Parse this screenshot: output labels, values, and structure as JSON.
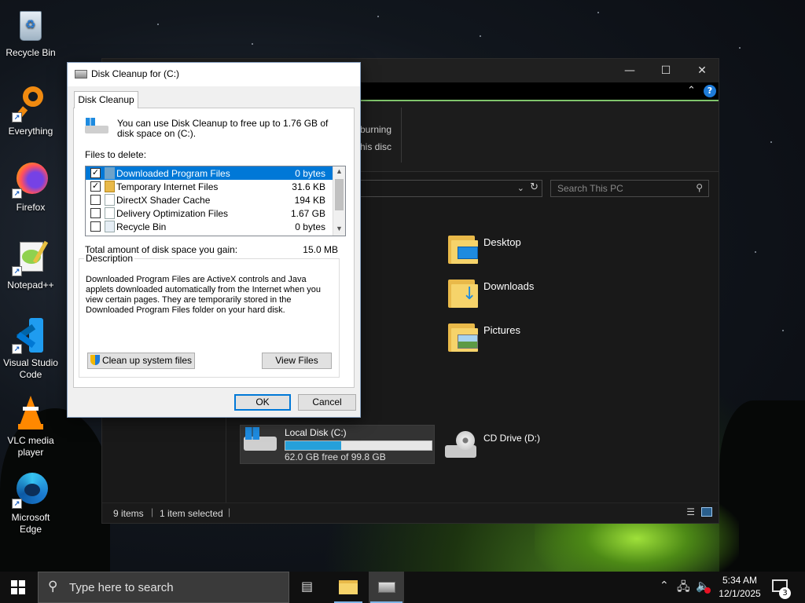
{
  "desktop": {
    "icons": [
      {
        "label": "Recycle Bin",
        "icon": "recycle-bin-icon"
      },
      {
        "label": "Everything",
        "icon": "search-magnifier-icon"
      },
      {
        "label": "Firefox",
        "icon": "firefox-icon"
      },
      {
        "label": "Notepad++",
        "icon": "notepad-plus-plus-icon"
      },
      {
        "label": "Visual Studio Code",
        "icon": "vscode-icon"
      },
      {
        "label": "VLC media player",
        "icon": "vlc-cone-icon"
      },
      {
        "label": "Microsoft Edge",
        "icon": "edge-icon"
      }
    ]
  },
  "explorer": {
    "ribbon_text_1": "burning",
    "ribbon_text_2": "his disc",
    "search_placeholder": "Search This PC",
    "folders": [
      {
        "label": "Desktop"
      },
      {
        "label": "Downloads"
      },
      {
        "label": "Pictures"
      }
    ],
    "drives": [
      {
        "label": "Local Disk (C:)",
        "free_text": "62.0 GB free of 99.8 GB",
        "used_fraction": 0.38
      },
      {
        "label": "CD Drive (D:)"
      }
    ],
    "status": {
      "items": "9 items",
      "selected": "1 item selected"
    }
  },
  "dialog": {
    "title": "Disk Cleanup for  (C:)",
    "tab": "Disk Cleanup",
    "intro": "You can use Disk Cleanup to free up to 1.76 GB of disk space on  (C:).",
    "files_label": "Files to delete:",
    "files": [
      {
        "name": "Downloaded Program Files",
        "size": "0 bytes",
        "checked": true,
        "selected": true
      },
      {
        "name": "Temporary Internet Files",
        "size": "31.6 KB",
        "checked": true,
        "selected": false
      },
      {
        "name": "DirectX Shader Cache",
        "size": "194 KB",
        "checked": false,
        "selected": false
      },
      {
        "name": "Delivery Optimization Files",
        "size": "1.67 GB",
        "checked": false,
        "selected": false
      },
      {
        "name": "Recycle Bin",
        "size": "0 bytes",
        "checked": false,
        "selected": false
      }
    ],
    "total_label": "Total amount of disk space you gain:",
    "total_value": "15.0 MB",
    "description_label": "Description",
    "description_text": "Downloaded Program Files are ActiveX controls and Java applets downloaded automatically from the Internet when you view certain pages. They are temporarily stored in the Downloaded Program Files folder on your hard disk.",
    "cleanup_system_button": "Clean up system files",
    "view_files_button": "View Files",
    "ok_button": "OK",
    "cancel_button": "Cancel"
  },
  "taskbar": {
    "search_placeholder": "Type here to search",
    "time": "5:34 AM",
    "date": "12/1/2025",
    "notification_count": "3"
  }
}
